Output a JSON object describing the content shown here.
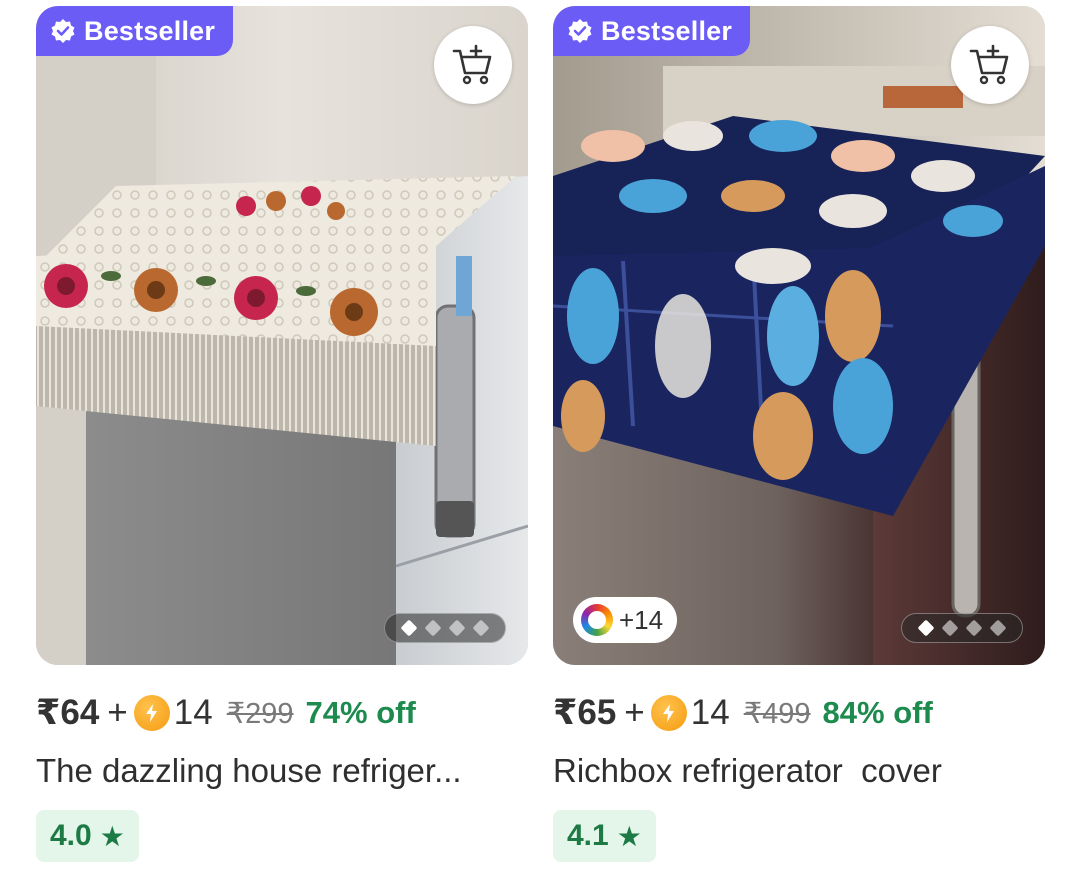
{
  "products": [
    {
      "badge": "Bestseller",
      "price": "₹64",
      "plus": "+",
      "coins": "14",
      "mrp": "₹299",
      "discount": "74% off",
      "title": "The dazzling house refriger...",
      "rating": "4.0",
      "rating_icon": "star-icon",
      "image_pager": {
        "total": 4,
        "active": 1
      },
      "colors": {
        "show": false,
        "label": ""
      }
    },
    {
      "badge": "Bestseller",
      "price": "₹65",
      "plus": "+",
      "coins": "14",
      "mrp": "₹499",
      "discount": "84% off",
      "title": "Richbox refrigerator  cover",
      "rating": "4.1",
      "rating_icon": "star-icon",
      "image_pager": {
        "total": 4,
        "active": 1
      },
      "colors": {
        "show": true,
        "label": "+14"
      }
    }
  ],
  "theme": {
    "badge_color": "#6b5cf6",
    "discount_color": "#1d8b4e",
    "rating_bg": "#e3f6e9",
    "coin_color": "#f59b10"
  }
}
